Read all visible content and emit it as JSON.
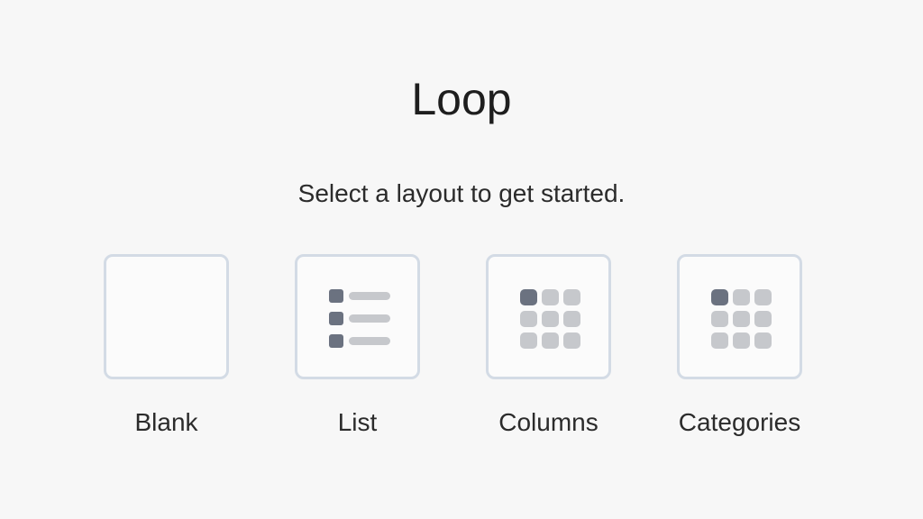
{
  "header": {
    "title": "Loop",
    "subtitle": "Select a layout to get started."
  },
  "layouts": [
    {
      "label": "Blank",
      "icon": "blank-layout-icon"
    },
    {
      "label": "List",
      "icon": "list-layout-icon"
    },
    {
      "label": "Columns",
      "icon": "grid-layout-icon"
    },
    {
      "label": "Categories",
      "icon": "grid-layout-icon"
    }
  ],
  "colors": {
    "background": "#f7f7f7",
    "tile_border": "#d3dbe5",
    "icon_dark": "#6b7280",
    "icon_light": "#c6c8cc"
  }
}
